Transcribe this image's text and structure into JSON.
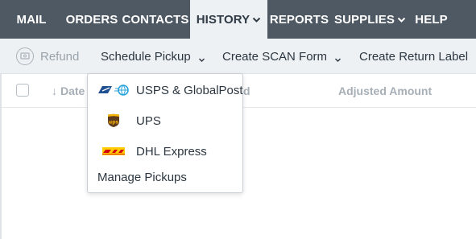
{
  "topnav": {
    "items": [
      {
        "label": "MAIL",
        "has_caret": false,
        "active": false
      },
      {
        "label": "ORDERS",
        "has_caret": false,
        "active": false
      },
      {
        "label": "CONTACTS",
        "has_caret": false,
        "active": false
      },
      {
        "label": "HISTORY",
        "has_caret": true,
        "active": true
      },
      {
        "label": "REPORTS",
        "has_caret": false,
        "active": false
      },
      {
        "label": "SUPPLIES",
        "has_caret": true,
        "active": false
      },
      {
        "label": "HELP",
        "has_caret": false,
        "active": false
      }
    ]
  },
  "toolbar": {
    "refund_label": "Refund",
    "schedule_pickup_label": "Schedule Pickup",
    "create_scan_form_label": "Create SCAN Form",
    "create_return_label": "Create Return Label"
  },
  "table": {
    "columns": [
      "Date",
      "Adjusted Amount"
    ],
    "partial_column_fragment": "d",
    "sort_arrow": "↓"
  },
  "dropdown": {
    "items": [
      {
        "label": "USPS & GlobalPost",
        "icon": "usps-globalpost-icon"
      },
      {
        "label": "UPS",
        "icon": "ups-logo-icon"
      },
      {
        "label": "DHL Express",
        "icon": "dhl-logo-icon"
      }
    ],
    "manage_label": "Manage Pickups"
  },
  "colors": {
    "nav_bg": "#4e5964",
    "nav_active_bg": "#eef1f4",
    "toolbar_bg": "#eef1f4",
    "ups_brown": "#5f3b1d",
    "ups_gold": "#f5b300",
    "dhl_yellow": "#ffcc00",
    "dhl_red": "#d40511",
    "usps_blue": "#1d4f91",
    "globalpost_blue": "#2aa3d8"
  }
}
